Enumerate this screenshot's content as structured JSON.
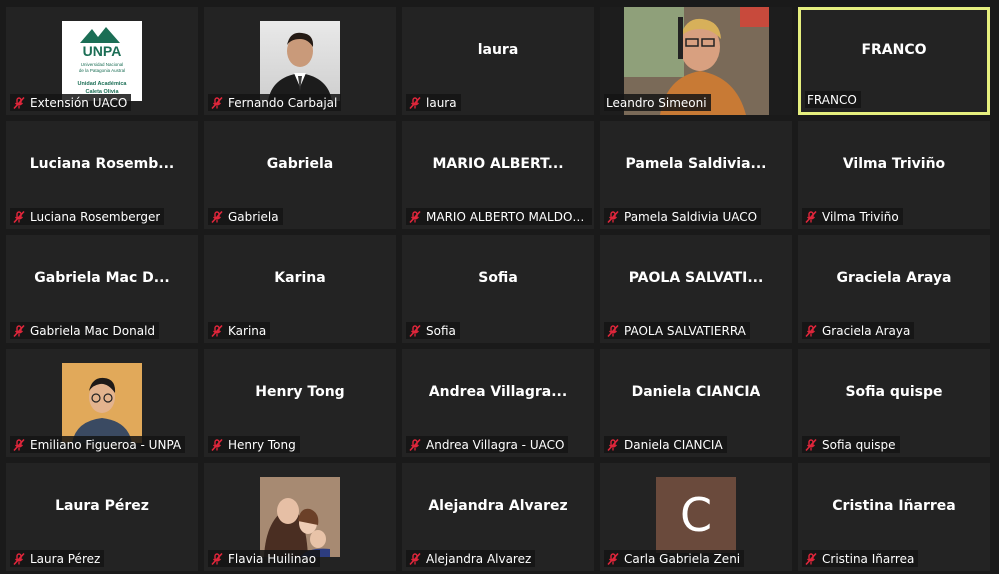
{
  "participants": [
    {
      "label": "Extensión UACO",
      "center": "",
      "media": "logo",
      "muted": true,
      "logo": {
        "brand": "UNPA",
        "line1": "Universidad Nacional",
        "line2": "de la Patagonia Austral",
        "line3": "Unidad Académica",
        "line4": "Caleta Olivia"
      }
    },
    {
      "label": "Fernando Carbajal",
      "center": "",
      "media": "photo-suit",
      "muted": true
    },
    {
      "label": "laura",
      "center": "laura",
      "media": "none",
      "muted": true
    },
    {
      "label": "Leandro Simeoni",
      "center": "",
      "media": "video",
      "muted": false
    },
    {
      "label": "FRANCO",
      "center": "FRANCO",
      "media": "none",
      "muted": false,
      "active": true
    },
    {
      "label": "Luciana Rosemberger",
      "center": "Luciana  Rosemb...",
      "media": "none",
      "muted": true
    },
    {
      "label": "Gabriela",
      "center": "Gabriela",
      "media": "none",
      "muted": true
    },
    {
      "label": "MARIO ALBERTO MALDON...",
      "center": "MARIO  ALBERT...",
      "media": "none",
      "muted": true
    },
    {
      "label": "Pamela Saldivia UACO",
      "center": "Pamela  Saldivia...",
      "media": "none",
      "muted": true
    },
    {
      "label": "Vilma Triviño",
      "center": "Vilma Triviño",
      "media": "none",
      "muted": true
    },
    {
      "label": "Gabriela Mac Donald",
      "center": "Gabriela  Mac  D...",
      "media": "none",
      "muted": true
    },
    {
      "label": "Karina",
      "center": "Karina",
      "media": "none",
      "muted": true
    },
    {
      "label": "Sofia",
      "center": "Sofia",
      "media": "none",
      "muted": true
    },
    {
      "label": "PAOLA SALVATIERRA",
      "center": "PAOLA  SALVATI...",
      "media": "none",
      "muted": true
    },
    {
      "label": "Graciela Araya",
      "center": "Graciela Araya",
      "media": "none",
      "muted": true
    },
    {
      "label": "Emiliano Figueroa - UNPA",
      "center": "",
      "media": "photo-glasses",
      "muted": true
    },
    {
      "label": "Henry Tong",
      "center": "Henry Tong",
      "media": "none",
      "muted": true
    },
    {
      "label": "Andrea Villagra - UACO",
      "center": "Andrea  Villagra...",
      "media": "none",
      "muted": true
    },
    {
      "label": "Daniela CIANCIA",
      "center": "Daniela CIANCIA",
      "media": "none",
      "muted": true
    },
    {
      "label": "Sofia quispe",
      "center": "Sofia quispe",
      "media": "none",
      "muted": true
    },
    {
      "label": "Laura Pérez",
      "center": "Laura Pérez",
      "media": "none",
      "muted": true
    },
    {
      "label": "Flavia Huilinao",
      "center": "",
      "media": "photo-family",
      "muted": true
    },
    {
      "label": "Alejandra Alvarez",
      "center": "Alejandra Alvarez",
      "media": "none",
      "muted": true
    },
    {
      "label": "Carla Gabriela Zeni",
      "center": "",
      "media": "letter",
      "letter": "C",
      "muted": true
    },
    {
      "label": "Cristina Iñarrea",
      "center": "Cristina Iñarrea",
      "media": "none",
      "muted": true
    }
  ],
  "colors": {
    "background": "#1a1a1a",
    "tile": "#232323",
    "active_border": "#e6ef7f",
    "muted_icon": "#e0263b"
  },
  "icons": {
    "muted": "mic-off-icon"
  }
}
